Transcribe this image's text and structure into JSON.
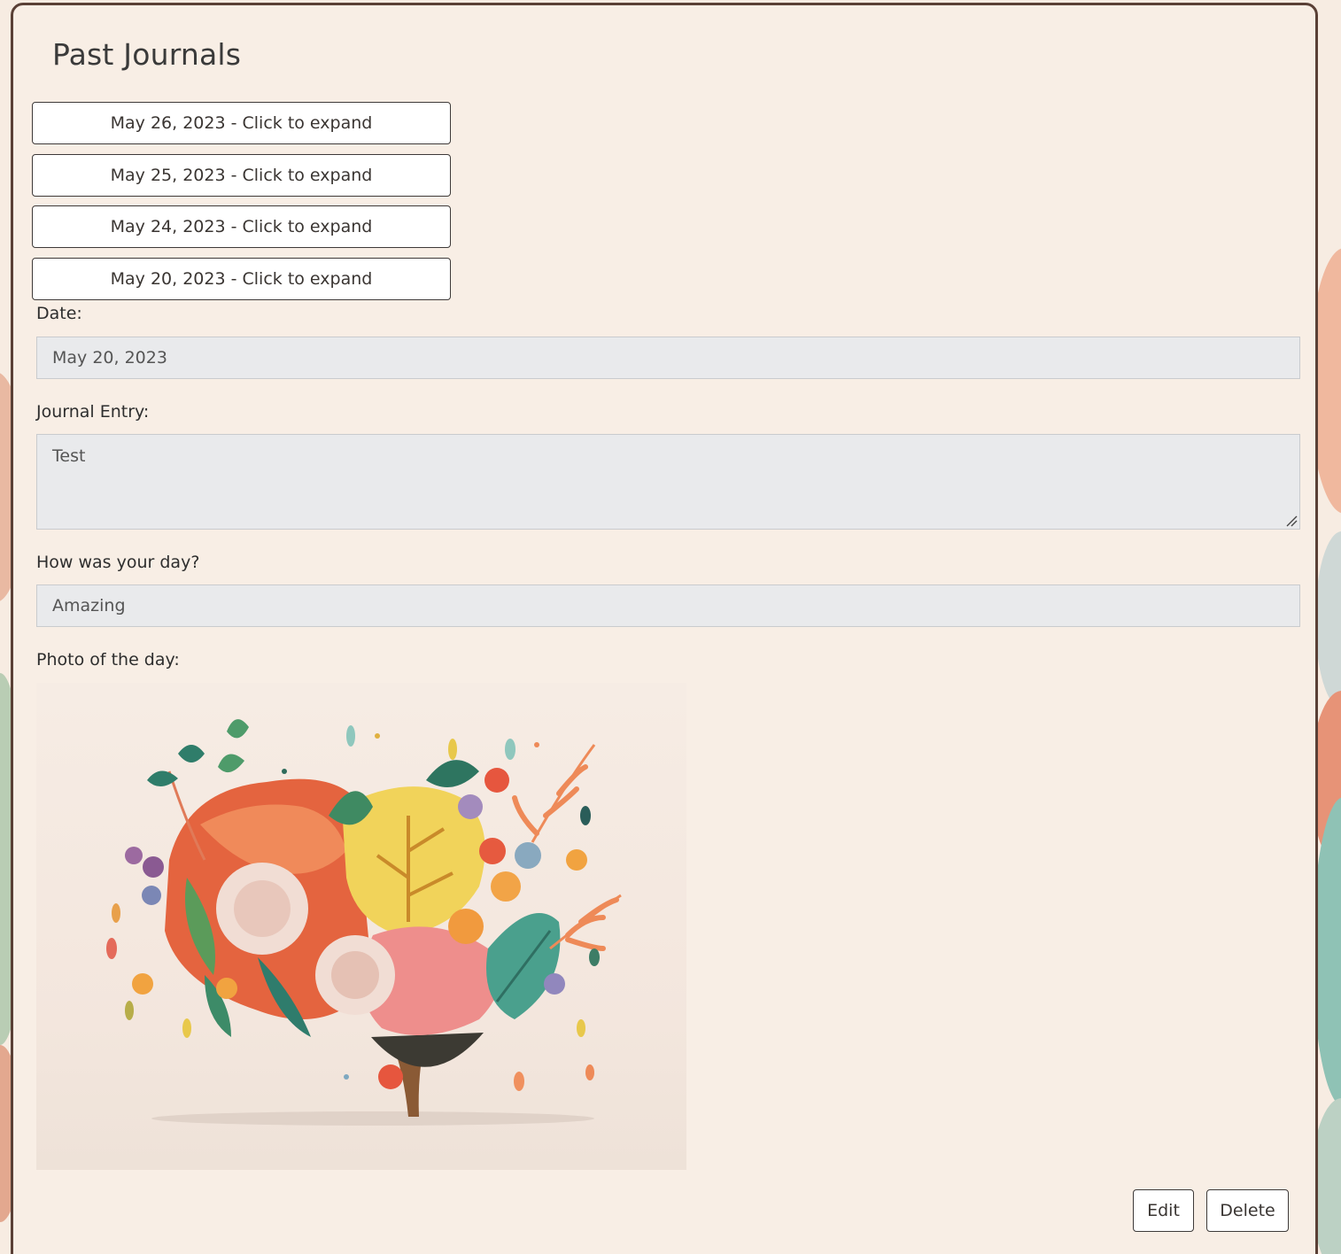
{
  "page": {
    "title": "Past Journals"
  },
  "entries": [
    {
      "label": "May 26, 2023 - Click to expand"
    },
    {
      "label": "May 25, 2023 - Click to expand"
    },
    {
      "label": "May 24, 2023 - Click to expand"
    },
    {
      "label": "May 20, 2023 - Click to expand"
    }
  ],
  "form": {
    "date_label": "Date:",
    "date_value": "May 20, 2023",
    "entry_label": "Journal Entry:",
    "entry_value": "Test",
    "mood_label": "How was your day?",
    "mood_value": "Amazing",
    "photo_label": "Photo of the day:"
  },
  "actions": {
    "edit_label": "Edit",
    "delete_label": "Delete"
  },
  "colors": {
    "page_bg": "#f8eee5",
    "panel_border": "#5a4036",
    "field_bg": "#e9eaec",
    "button_bg": "#ffffff"
  }
}
